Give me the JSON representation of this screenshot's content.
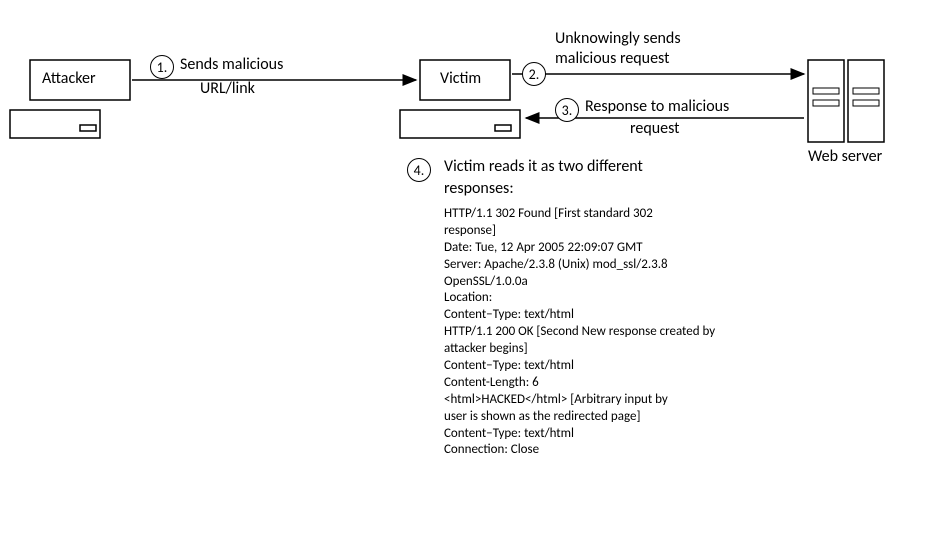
{
  "nodes": {
    "attacker": {
      "label": "Attacker"
    },
    "victim": {
      "label": "Victim"
    },
    "webserver": {
      "label": "Web server"
    }
  },
  "steps": {
    "s1": {
      "num": "1.",
      "text1": "Sends malicious",
      "text2": "URL/link"
    },
    "s2": {
      "num": "2.",
      "text1": "Unknowingly sends",
      "text2": "malicious request"
    },
    "s3": {
      "num": "3.",
      "text1": "Response to malicious",
      "text2": "request"
    },
    "s4": {
      "num": "4.",
      "heading1": "Victim reads it as two different",
      "heading2": "responses:",
      "lines": [
        "HTTP/1.1 302  Found [First standard 302",
        "response]",
        "Date: Tue, 12  Apr 2005  22:09:07  GMT",
        "Server: Apache/2.3.8 (Unix) mod_ssl/2.3.8",
        "OpenSSL/1.0.0a",
        "Location:",
        "Content−Type: text/html",
        "HTTP/1.1 200  OK [Second New response created by",
        "attacker begins]",
        "Content−Type: text/html",
        "Content-Length: 6",
        "<html>HACKED</html> [Arbitrary input by",
        "user is shown as the redirected page]",
        "Content−Type: text/html",
        "Connection: Close"
      ]
    }
  }
}
